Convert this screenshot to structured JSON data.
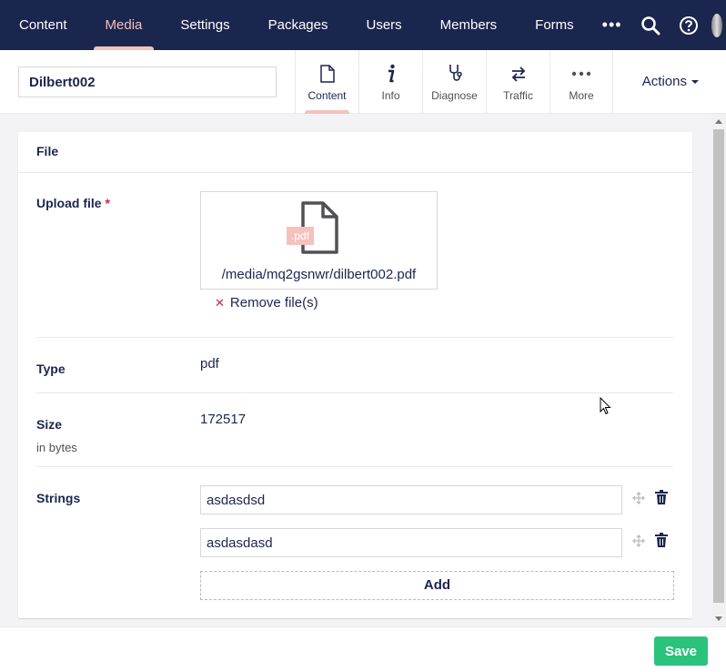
{
  "topnav": {
    "items": [
      {
        "label": "Content",
        "active": false
      },
      {
        "label": "Media",
        "active": true
      },
      {
        "label": "Settings",
        "active": false
      },
      {
        "label": "Packages",
        "active": false
      },
      {
        "label": "Users",
        "active": false
      },
      {
        "label": "Members",
        "active": false
      },
      {
        "label": "Forms",
        "active": false
      }
    ],
    "more_glyph": "•••",
    "icons": [
      "more-icon",
      "search-icon",
      "help-icon",
      "user-avatar"
    ],
    "bg_color": "#1b264f",
    "active_color": "#f5c1bc"
  },
  "header": {
    "name_value": "Dilbert002",
    "apps": [
      {
        "label": "Content",
        "icon": "document-icon",
        "active": true
      },
      {
        "label": "Info",
        "icon": "info-icon",
        "active": false
      },
      {
        "label": "Diagnose",
        "icon": "stethoscope-icon",
        "active": false
      },
      {
        "label": "Traffic",
        "icon": "arrows-icon",
        "active": false
      },
      {
        "label": "More",
        "icon": "ellipsis-icon",
        "active": false
      }
    ],
    "actions_label": "Actions"
  },
  "panel": {
    "title": "File",
    "upload": {
      "label": "Upload file",
      "required_mark": "*",
      "file_ext": ".pdf",
      "file_path": "/media/mq2gsnwr/dilbert002.pdf",
      "remove_glyph": "✕",
      "remove_label": "Remove file(s)"
    },
    "type": {
      "label": "Type",
      "value": "pdf"
    },
    "size": {
      "label": "Size",
      "description": "in bytes",
      "value": "172517"
    },
    "strings": {
      "label": "Strings",
      "items": [
        "asdasdsd",
        "asdasdasd"
      ],
      "add_label": "Add"
    }
  },
  "footer": {
    "save_label": "Save",
    "save_color": "#2bc37c"
  }
}
